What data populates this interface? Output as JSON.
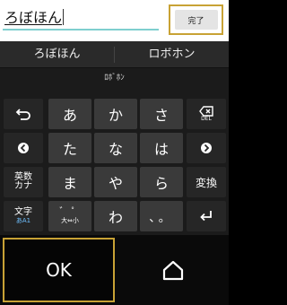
{
  "input": {
    "text": "ろぼほん"
  },
  "done_button": {
    "label": "完了"
  },
  "candidates": [
    {
      "label": "ろぼほん"
    },
    {
      "label": "ロボホン"
    }
  ],
  "reading": "ﾛﾎﾞﾎﾝ",
  "keys": {
    "undo": {
      "icon": "undo-arrow-icon",
      "glyph": "⮌"
    },
    "a": "あ",
    "ka": "か",
    "sa": "さ",
    "delete": {
      "icon": "backspace-icon",
      "label": "DEL"
    },
    "left": {
      "icon": "left-arrow-icon"
    },
    "ta": "た",
    "na": "な",
    "ha": "は",
    "right": {
      "icon": "right-arrow-icon"
    },
    "mode_eisu": {
      "top": "英数",
      "bottom": "カナ"
    },
    "ma": "ま",
    "ya": "や",
    "ra": "ら",
    "convert": "変換",
    "char_type": {
      "top": "文字",
      "sub": "あA1"
    },
    "daku": {
      "top": "゛ ゜",
      "bottom": "大⇔小"
    },
    "wa": "わ",
    "punct": "、。",
    "enter": {
      "icon": "enter-icon"
    }
  },
  "bottom": {
    "ok_label": "OK",
    "home_icon": "home-icon"
  },
  "colors": {
    "highlight": "#c8a235",
    "input_underline": "#7fcfcf",
    "key_bg": "#3a3a3a"
  }
}
